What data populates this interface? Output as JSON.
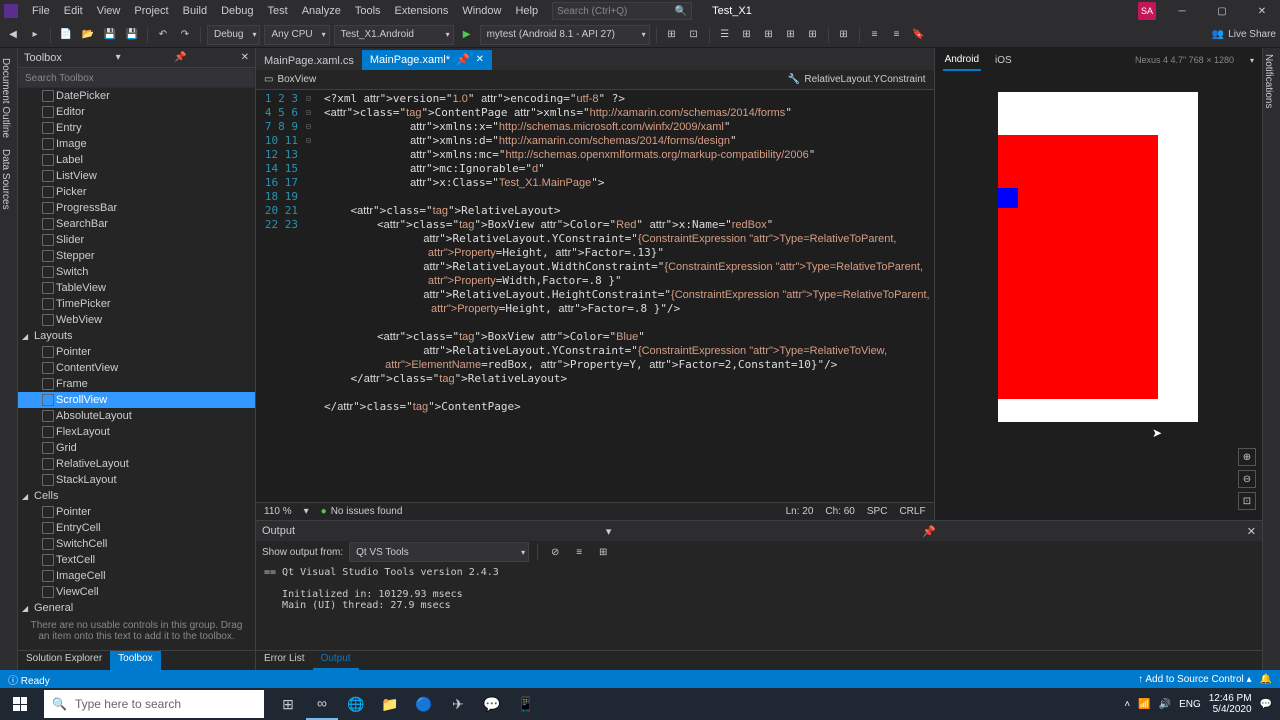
{
  "titlebar": {
    "menus": [
      "File",
      "Edit",
      "View",
      "Project",
      "Build",
      "Debug",
      "Test",
      "Analyze",
      "Tools",
      "Extensions",
      "Window",
      "Help"
    ],
    "search_placeholder": "Search (Ctrl+Q)",
    "solution_name": "Test_X1",
    "avatar": "SA"
  },
  "toolbar": {
    "config": "Debug",
    "platform": "Any CPU",
    "project": "Test_X1.Android",
    "run_target": "mytest (Android 8.1 - API 27)",
    "live_share": "Live Share"
  },
  "toolbox": {
    "title": "Toolbox",
    "search_placeholder": "Search Toolbox",
    "controls": [
      "DatePicker",
      "Editor",
      "Entry",
      "Image",
      "Label",
      "ListView",
      "Picker",
      "ProgressBar",
      "SearchBar",
      "Slider",
      "Stepper",
      "Switch",
      "TableView",
      "TimePicker",
      "WebView"
    ],
    "layouts_label": "Layouts",
    "layouts": [
      "Pointer",
      "ContentView",
      "Frame",
      "ScrollView",
      "AbsoluteLayout",
      "FlexLayout",
      "Grid",
      "RelativeLayout",
      "StackLayout"
    ],
    "selected": "ScrollView",
    "cells_label": "Cells",
    "cells": [
      "Pointer",
      "EntryCell",
      "SwitchCell",
      "TextCell",
      "ImageCell",
      "ViewCell"
    ],
    "general_label": "General",
    "hint": "There are no usable controls in this group. Drag an item onto this text to add it to the toolbox.",
    "tabs": {
      "solution": "Solution Explorer",
      "toolbox": "Toolbox"
    }
  },
  "tabs": {
    "t1": "MainPage.xaml.cs",
    "t2": "MainPage.xaml*"
  },
  "navbar": {
    "left": "BoxView",
    "right": "RelativeLayout.YConstraint"
  },
  "code": {
    "lines": [
      "<?xml version=\"1.0\" encoding=\"utf-8\" ?>",
      "<ContentPage xmlns=\"http://xamarin.com/schemas/2014/forms\"",
      "             xmlns:x=\"http://schemas.microsoft.com/winfx/2009/xaml\"",
      "             xmlns:d=\"http://xamarin.com/schemas/2014/forms/design\"",
      "             xmlns:mc=\"http://schemas.openxmlformats.org/markup-compatibility/2006\"",
      "             mc:Ignorable=\"d\"",
      "             x:Class=\"Test_X1.MainPage\">",
      "",
      "    <RelativeLayout>",
      "        <BoxView Color=\"Red\" x:Name=\"redBox\"",
      "               RelativeLayout.YConstraint=\"{ConstraintExpression Type=RelativeToParent,",
      "                                  Property=Height, Factor=.13}\"",
      "               RelativeLayout.WidthConstraint=\"{ConstraintExpression Type=RelativeToParent,",
      "                                  Property=Width,Factor=.8 }\"",
      "               RelativeLayout.HeightConstraint=\"{ConstraintExpression Type=RelativeToParent,",
      "                                   Property=Height, Factor=.8 }\"/>",
      "",
      "        <BoxView Color=\"Blue\"",
      "               RelativeLayout.YConstraint=\"{ConstraintExpression Type=RelativeToView,",
      "                    ElementName=redBox, Property=Y, Factor=2,Constant=10}\"/>",
      "    </RelativeLayout>",
      "",
      "</ContentPage>"
    ]
  },
  "editor_status": {
    "zoom": "110 %",
    "issues": "No issues found",
    "ln": "Ln: 20",
    "ch": "Ch: 60",
    "spc": "SPC",
    "crlf": "CRLF"
  },
  "preview": {
    "tab_android": "Android",
    "tab_ios": "iOS",
    "device": "Nexus 4  4.7\"  768 × 1280"
  },
  "output": {
    "title": "Output",
    "show_from_label": "Show output from:",
    "show_from_value": "Qt VS Tools",
    "content": "== Qt Visual Studio Tools version 2.4.3\n\n   Initialized in: 10129.93 msecs\n   Main (UI) thread: 27.9 msecs",
    "tabs": {
      "error_list": "Error List",
      "output": "Output"
    }
  },
  "statusbar": {
    "ready": "Ready",
    "source_control": "Add to Source Control"
  },
  "taskbar": {
    "search": "Type here to search",
    "time": "12:46 PM",
    "date": "5/4/2020"
  },
  "side_tabs": {
    "doc_outline": "Document Outline",
    "data_sources": "Data Sources",
    "notifications": "Notifications"
  }
}
